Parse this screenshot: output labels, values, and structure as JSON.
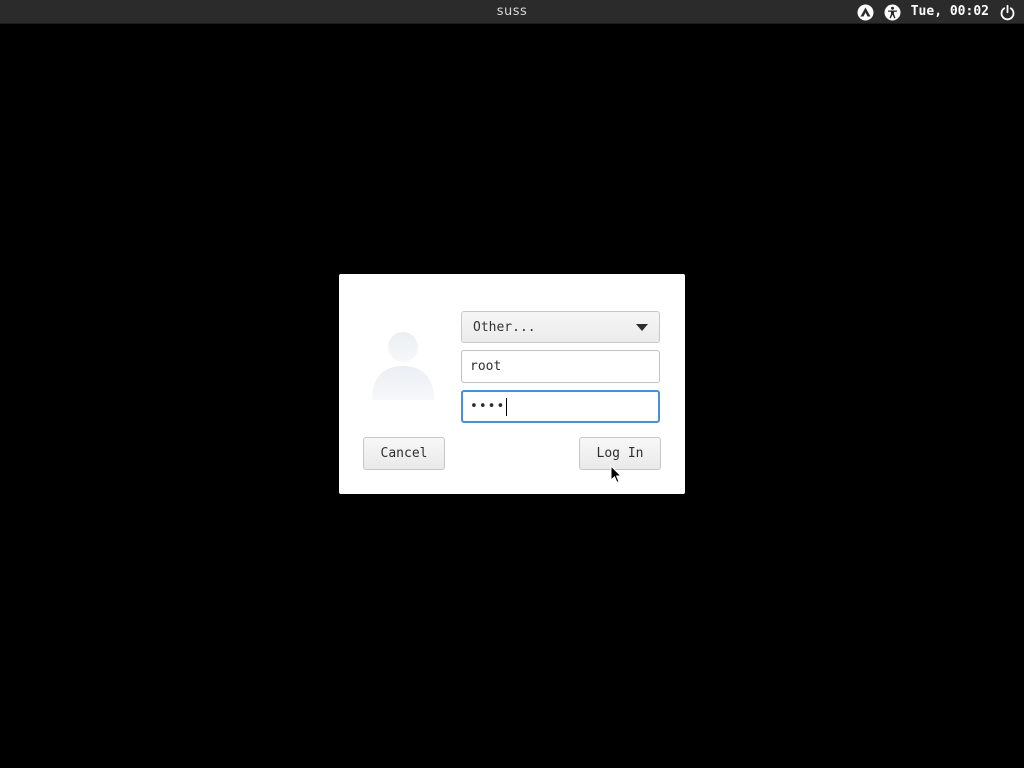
{
  "topbar": {
    "hostname": "suss",
    "clock": "Tue, 00:02",
    "icons": [
      "network-icon",
      "accessibility-icon",
      "power-icon"
    ]
  },
  "dialog": {
    "user_select": {
      "selected": "Other..."
    },
    "username": {
      "value": "root",
      "placeholder": ""
    },
    "password": {
      "masked_value": "••••"
    },
    "buttons": {
      "cancel": "Cancel",
      "login": "Log In"
    }
  },
  "colors": {
    "topbar_bg": "#2b2b2b",
    "desktop_bg": "#000000",
    "dialog_bg": "#ffffff",
    "focus_ring": "#4a90d9"
  }
}
